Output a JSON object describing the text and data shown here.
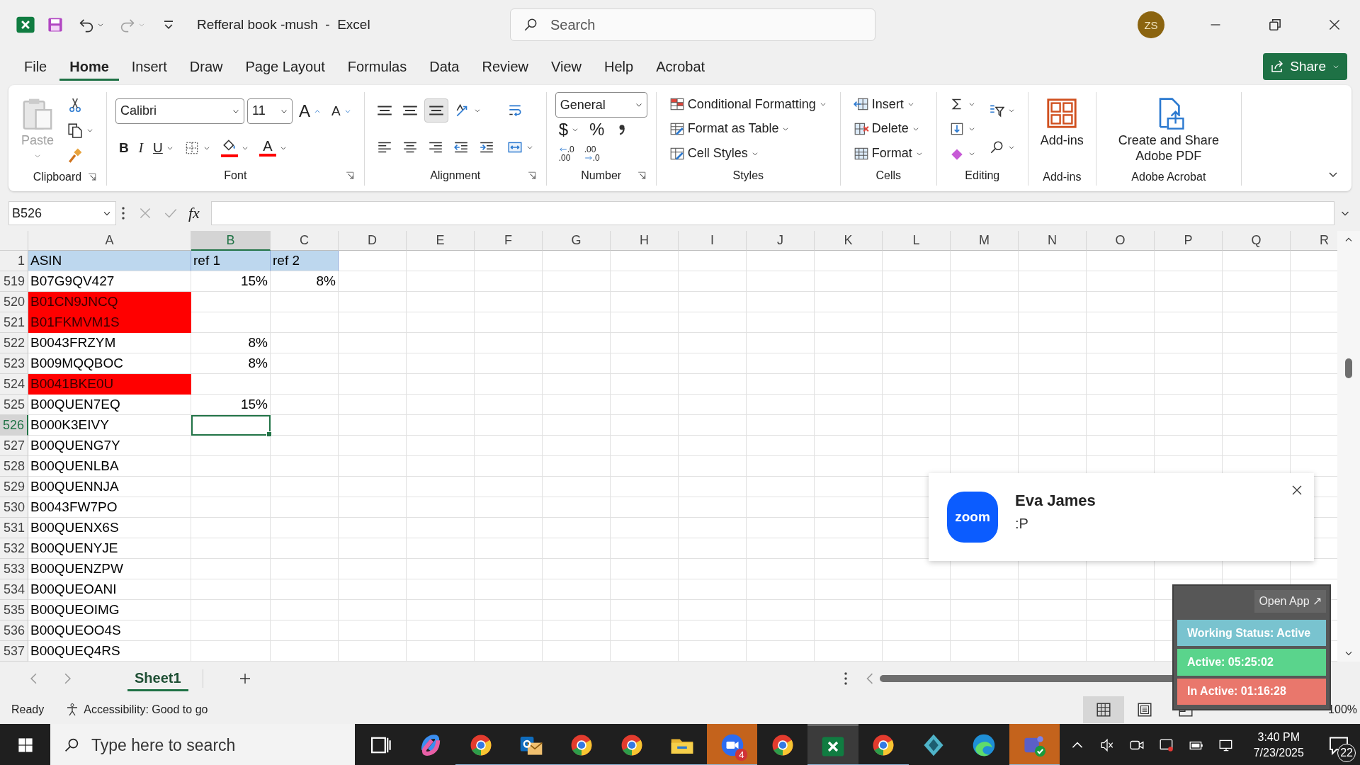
{
  "title_bar": {
    "title": "Refferal book -mush  -  Excel",
    "search": {
      "placeholder": "Search"
    },
    "avatar": {
      "initials": "ZS",
      "color": "#8b6410"
    },
    "quick_access": [
      {
        "kind": "save",
        "disabled": false,
        "dropdown": false
      },
      {
        "kind": "undo",
        "disabled": false,
        "dropdown": true
      },
      {
        "kind": "redo",
        "disabled": true,
        "dropdown": true
      },
      {
        "kind": "customize",
        "disabled": false,
        "dropdown": false
      }
    ]
  },
  "menu_tabs": [
    {
      "label": "File",
      "selected": false
    },
    {
      "label": "Home",
      "selected": true
    },
    {
      "label": "Insert",
      "selected": false
    },
    {
      "label": "Draw",
      "selected": false
    },
    {
      "label": "Page Layout",
      "selected": false
    },
    {
      "label": "Formulas",
      "selected": false
    },
    {
      "label": "Data",
      "selected": false
    },
    {
      "label": "Review",
      "selected": false
    },
    {
      "label": "View",
      "selected": false
    },
    {
      "label": "Help",
      "selected": false
    },
    {
      "label": "Acrobat",
      "selected": false
    }
  ],
  "share_button": {
    "label": "Share"
  },
  "ribbon": {
    "groups": [
      {
        "label": "Clipboard",
        "launcher": true,
        "sections": [
          {
            "lines": [
              {
                "controls": [
                  {
                    "kind": "paste",
                    "label": "Paste",
                    "disabled": true,
                    "dropdown": true
                  }
                ]
              }
            ]
          },
          {
            "lines": [
              {
                "controls": [
                  {
                    "kind": "cut"
                  }
                ]
              },
              {
                "controls": [
                  {
                    "kind": "copy",
                    "dropdown": true
                  }
                ]
              },
              {
                "controls": [
                  {
                    "kind": "format-painter"
                  }
                ]
              }
            ]
          }
        ]
      },
      {
        "label": "Font",
        "launcher": true,
        "sections": [
          {
            "lines": [
              {
                "controls": [
                  {
                    "kind": "font-box",
                    "label": "Calibri"
                  },
                  {
                    "kind": "size-box",
                    "label": "11"
                  },
                  {
                    "kind": "grow-font",
                    "label": "A"
                  },
                  {
                    "kind": "shrink-font",
                    "label": "A"
                  }
                ]
              },
              {
                "controls": [
                  {
                    "kind": "bold",
                    "label": "B"
                  },
                  {
                    "kind": "italic",
                    "label": "I"
                  },
                  {
                    "kind": "underline",
                    "label": "U",
                    "dropdown": true
                  },
                  {
                    "kind": "borders",
                    "dropdown": true
                  },
                  {
                    "kind": "fill-color",
                    "color": "#ff0000",
                    "dropdown": true
                  },
                  {
                    "kind": "font-color",
                    "label": "A",
                    "color": "#ff0000",
                    "dropdown": true
                  }
                ]
              }
            ]
          }
        ]
      },
      {
        "label": "Alignment",
        "launcher": true,
        "sections": [
          {
            "lines": [
              {
                "controls": [
                  {
                    "kind": "align-top",
                    "selected": false
                  },
                  {
                    "kind": "align-middle",
                    "selected": false
                  },
                  {
                    "kind": "align-bottom",
                    "selected": true
                  },
                  {
                    "kind": "orientation",
                    "dropdown": true
                  }
                ]
              },
              {
                "controls": [
                  {
                    "kind": "align-left"
                  },
                  {
                    "kind": "align-center"
                  },
                  {
                    "kind": "align-right"
                  },
                  {
                    "kind": "outdent"
                  },
                  {
                    "kind": "indent"
                  }
                ]
              }
            ]
          },
          {
            "lines": [
              {
                "controls": [
                  {
                    "kind": "wrap"
                  }
                ]
              },
              {
                "controls": [
                  {
                    "kind": "merge",
                    "dropdown": true
                  }
                ]
              }
            ]
          }
        ]
      },
      {
        "label": "Number",
        "launcher": true,
        "sections": [
          {
            "lines": [
              {
                "controls": [
                  {
                    "kind": "format-box",
                    "label": "General"
                  }
                ]
              },
              {
                "controls": [
                  {
                    "kind": "currency",
                    "label": "$",
                    "dropdown": true
                  },
                  {
                    "kind": "percent",
                    "label": "%"
                  },
                  {
                    "kind": "comma"
                  }
                ]
              },
              {
                "controls": [
                  {
                    "kind": "add-decimal",
                    "top": ".0",
                    "bottom": ".00"
                  },
                  {
                    "kind": "remove-decimal",
                    "top": ".00",
                    "bottom": ".0"
                  }
                ]
              }
            ]
          }
        ]
      },
      {
        "label": "Styles",
        "launcher": false,
        "sections": [
          {
            "lines": [
              {
                "controls": [
                  {
                    "kind": "conditional-formatting",
                    "label": "Conditional Formatting",
                    "dropdown": true
                  }
                ]
              },
              {
                "controls": [
                  {
                    "kind": "format-as-table",
                    "label": "Format as Table",
                    "dropdown": true
                  }
                ]
              },
              {
                "controls": [
                  {
                    "kind": "cell-styles",
                    "label": "Cell Styles",
                    "dropdown": true
                  }
                ]
              }
            ]
          }
        ]
      },
      {
        "label": "Cells",
        "launcher": false,
        "sections": [
          {
            "lines": [
              {
                "controls": [
                  {
                    "kind": "insert-cells",
                    "label": "Insert",
                    "dropdown": true
                  }
                ]
              },
              {
                "controls": [
                  {
                    "kind": "delete-cells",
                    "label": "Delete",
                    "dropdown": true
                  }
                ]
              },
              {
                "controls": [
                  {
                    "kind": "format-cells",
                    "label": "Format",
                    "dropdown": true
                  }
                ]
              }
            ]
          }
        ]
      },
      {
        "label": "Editing",
        "launcher": false,
        "sections": [
          {
            "lines": [
              {
                "controls": [
                  {
                    "kind": "autosum",
                    "dropdown": true
                  }
                ]
              },
              {
                "controls": [
                  {
                    "kind": "fill",
                    "dropdown": true
                  }
                ]
              },
              {
                "controls": [
                  {
                    "kind": "clear",
                    "dropdown": true
                  }
                ]
              }
            ]
          },
          {
            "lines": [
              {
                "controls": [
                  {
                    "kind": "sort-filter",
                    "dropdown": true
                  }
                ]
              },
              {
                "controls": [
                  {
                    "kind": "find",
                    "dropdown": true
                  }
                ]
              }
            ]
          }
        ]
      },
      {
        "label": "Add-ins",
        "launcher": false,
        "sections": [
          {
            "lines": [
              {
                "controls": [
                  {
                    "kind": "add-ins",
                    "label": "Add-ins"
                  }
                ]
              }
            ]
          }
        ]
      },
      {
        "label": "Adobe Acrobat",
        "launcher": false,
        "sections": [
          {
            "lines": [
              {
                "controls": [
                  {
                    "kind": "create-pdf",
                    "label": "Create and Share Adobe PDF"
                  }
                ]
              }
            ]
          }
        ]
      }
    ]
  },
  "formula_bar": {
    "name_box": "B526",
    "function_label": "fx"
  },
  "grid": {
    "columns": [
      {
        "label": "A",
        "selected": false
      },
      {
        "label": "B",
        "selected": true
      },
      {
        "label": "C",
        "selected": false
      },
      {
        "label": "D",
        "selected": false
      },
      {
        "label": "E",
        "selected": false
      },
      {
        "label": "F",
        "selected": false
      },
      {
        "label": "G",
        "selected": false
      },
      {
        "label": "H",
        "selected": false
      },
      {
        "label": "I",
        "selected": false
      },
      {
        "label": "J",
        "selected": false
      },
      {
        "label": "K",
        "selected": false
      },
      {
        "label": "L",
        "selected": false
      },
      {
        "label": "M",
        "selected": false
      },
      {
        "label": "N",
        "selected": false
      },
      {
        "label": "O",
        "selected": false
      },
      {
        "label": "P",
        "selected": false
      },
      {
        "label": "Q",
        "selected": false
      },
      {
        "label": "R",
        "selected": false
      }
    ],
    "header_row": {
      "number": "1",
      "cells": [
        "ASIN",
        "ref 1",
        "ref 2"
      ],
      "color": "#bdd7ee"
    },
    "rows": [
      {
        "number": "519",
        "asin": "B07G9QV427",
        "ref_1": "15%",
        "ref_2": "8%",
        "selected": false
      },
      {
        "number": "520",
        "asin": "B01CN9JNCQ",
        "color": "#ff0000",
        "selected": false
      },
      {
        "number": "521",
        "asin": "B01FKMVM1S",
        "color": "#ff0000",
        "selected": false
      },
      {
        "number": "522",
        "asin": "B0043FRZYM",
        "ref_1": "8%",
        "selected": false
      },
      {
        "number": "523",
        "asin": "B009MQQBOC",
        "ref_1": "8%",
        "selected": false
      },
      {
        "number": "524",
        "asin": "B0041BKE0U",
        "color": "#ff0000",
        "selected": false
      },
      {
        "number": "525",
        "asin": "B00QUEN7EQ",
        "ref_1": "15%",
        "selected": false
      },
      {
        "number": "526",
        "asin": "B000K3EIVY",
        "selected": true
      },
      {
        "number": "527",
        "asin": "B00QUENG7Y",
        "selected": false
      },
      {
        "number": "528",
        "asin": "B00QUENLBA",
        "selected": false
      },
      {
        "number": "529",
        "asin": "B00QUENNJA",
        "selected": false
      },
      {
        "number": "530",
        "asin": "B0043FW7PO",
        "selected": false
      },
      {
        "number": "531",
        "asin": "B00QUENX6S",
        "selected": false
      },
      {
        "number": "532",
        "asin": "B00QUENYJE",
        "selected": false
      },
      {
        "number": "533",
        "asin": "B00QUENZPW",
        "selected": false
      },
      {
        "number": "534",
        "asin": "B00QUEOANI",
        "selected": false
      },
      {
        "number": "535",
        "asin": "B00QUEOIMG",
        "selected": false
      },
      {
        "number": "536",
        "asin": "B00QUEOO4S",
        "selected": false
      },
      {
        "number": "537",
        "asin": "B00QUEQ4RS",
        "selected": false
      }
    ]
  },
  "sheet_tabs": [
    {
      "label": "Sheet1",
      "selected": true
    }
  ],
  "status_bar": {
    "mode": "Ready",
    "accessibility": "Accessibility: Good to go",
    "zoom": "100%",
    "views": [
      {
        "kind": "normal",
        "selected": true
      },
      {
        "kind": "page-layout",
        "selected": false
      },
      {
        "kind": "page-break",
        "selected": false
      }
    ]
  },
  "notification": {
    "logo": "zoom",
    "sender": "Eva James",
    "message": ":P"
  },
  "time_tracker": {
    "open_button": "Open App ↗",
    "rows": [
      {
        "text": "Working Status: Active",
        "color": "#79c3cf"
      },
      {
        "text": "Active: 05:25:02",
        "color": "#5ad48c"
      },
      {
        "text": "In Active: 01:16:28",
        "color": "#e9776c"
      }
    ]
  },
  "taskbar": {
    "search": {
      "placeholder": "Type here to search"
    },
    "apps": [
      {
        "kind": "task-view",
        "running": false,
        "selected": false,
        "attention": false
      },
      {
        "kind": "copilot",
        "running": false,
        "selected": false,
        "attention": false
      },
      {
        "kind": "browser",
        "running": true,
        "selected": false,
        "attention": false
      },
      {
        "kind": "mail",
        "running": true,
        "selected": false,
        "attention": false
      },
      {
        "kind": "browser",
        "running": true,
        "selected": false,
        "attention": false
      },
      {
        "kind": "browser",
        "running": true,
        "selected": false,
        "attention": false
      },
      {
        "kind": "folder",
        "running": true,
        "selected": false,
        "attention": false
      },
      {
        "kind": "video-call",
        "running": true,
        "selected": false,
        "attention": true,
        "badge": "4"
      },
      {
        "kind": "browser",
        "running": false,
        "selected": false,
        "attention": false
      },
      {
        "kind": "spreadsheet",
        "running": true,
        "selected": true,
        "attention": false
      },
      {
        "kind": "browser",
        "running": true,
        "selected": false,
        "attention": false
      },
      {
        "kind": "diamond",
        "running": false,
        "selected": false,
        "attention": false
      },
      {
        "kind": "edge",
        "running": false,
        "selected": false,
        "attention": false
      },
      {
        "kind": "chat",
        "running": true,
        "selected": false,
        "attention": true
      }
    ],
    "time": "3:40 PM",
    "date": "7/23/2025",
    "notifications": "22"
  }
}
